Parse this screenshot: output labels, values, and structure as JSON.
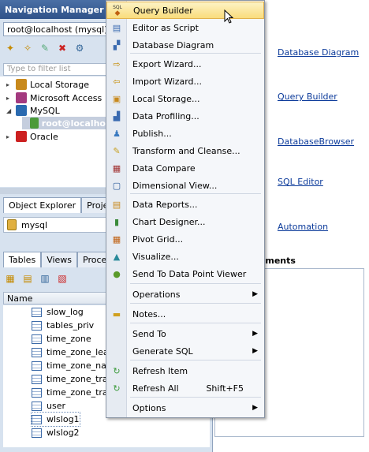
{
  "nav": {
    "title": "Navigation Manager",
    "connection": "root@localhost (mysql)",
    "filter_placeholder": "Type to filter list",
    "tree": [
      {
        "label": "Local Storage",
        "icon": "local-storage-icon",
        "color": "#c8891c"
      },
      {
        "label": "Microsoft Access",
        "icon": "access-icon",
        "color": "#a33a7f"
      },
      {
        "label": "MySQL",
        "icon": "mysql-icon",
        "color": "#2a6ab0"
      },
      {
        "label": "root@localho",
        "icon": "connection-icon",
        "color": "#4a9a3a"
      },
      {
        "label": "Oracle",
        "icon": "oracle-icon",
        "color": "#cc2020"
      }
    ]
  },
  "explorer": {
    "tabs": [
      "Object Explorer",
      "Proje"
    ],
    "database": "mysql",
    "subtabs": [
      "Tables",
      "Views",
      "Proce"
    ],
    "column_header": "Name",
    "tables": [
      "slow_log",
      "tables_priv",
      "time_zone",
      "time_zone_leap",
      "time_zone_nam",
      "time_zone_tran",
      "time_zone_tran",
      "user",
      "wlslog1",
      "wlslog2"
    ]
  },
  "right": {
    "links": [
      "Database Diagram",
      "Query Builder",
      "DatabaseBrowser",
      "SQL Editor",
      "Automation"
    ],
    "docs_title": "cuments"
  },
  "menu": {
    "items": [
      {
        "label": "Query Builder",
        "icon": "query-builder-icon",
        "highlighted": true
      },
      {
        "label": "Editor as Script",
        "icon": "editor-script-icon"
      },
      {
        "label": "Database Diagram",
        "icon": "database-diagram-icon"
      },
      {
        "label": "Export Wizard...",
        "icon": "export-icon"
      },
      {
        "label": "Import Wizard...",
        "icon": "import-icon"
      },
      {
        "label": "Local Storage...",
        "icon": "local-storage-icon"
      },
      {
        "label": "Data Profiling...",
        "icon": "data-profiling-icon"
      },
      {
        "label": "Publish...",
        "icon": "publish-icon"
      },
      {
        "label": "Transform and Cleanse...",
        "icon": "transform-icon"
      },
      {
        "label": "Data Compare",
        "icon": "data-compare-icon"
      },
      {
        "label": "Dimensional View...",
        "icon": "dimensional-view-icon"
      },
      {
        "label": "Data Reports...",
        "icon": "data-reports-icon"
      },
      {
        "label": "Chart Designer...",
        "icon": "chart-designer-icon"
      },
      {
        "label": "Pivot Grid...",
        "icon": "pivot-grid-icon"
      },
      {
        "label": "Visualize...",
        "icon": "visualize-icon"
      },
      {
        "label": "Send To Data Point Viewer",
        "icon": "data-point-viewer-icon"
      },
      {
        "label": "Operations",
        "submenu": true
      },
      {
        "label": "Notes...",
        "icon": "notes-icon"
      },
      {
        "label": "Send To",
        "submenu": true
      },
      {
        "label": "Generate SQL",
        "submenu": true
      },
      {
        "label": "Refresh Item",
        "icon": "refresh-icon"
      },
      {
        "label": "Refresh All",
        "icon": "refresh-all-icon",
        "shortcut": "Shift+F5"
      },
      {
        "label": "Options",
        "submenu": true
      }
    ],
    "sql_badge": "SQL"
  }
}
